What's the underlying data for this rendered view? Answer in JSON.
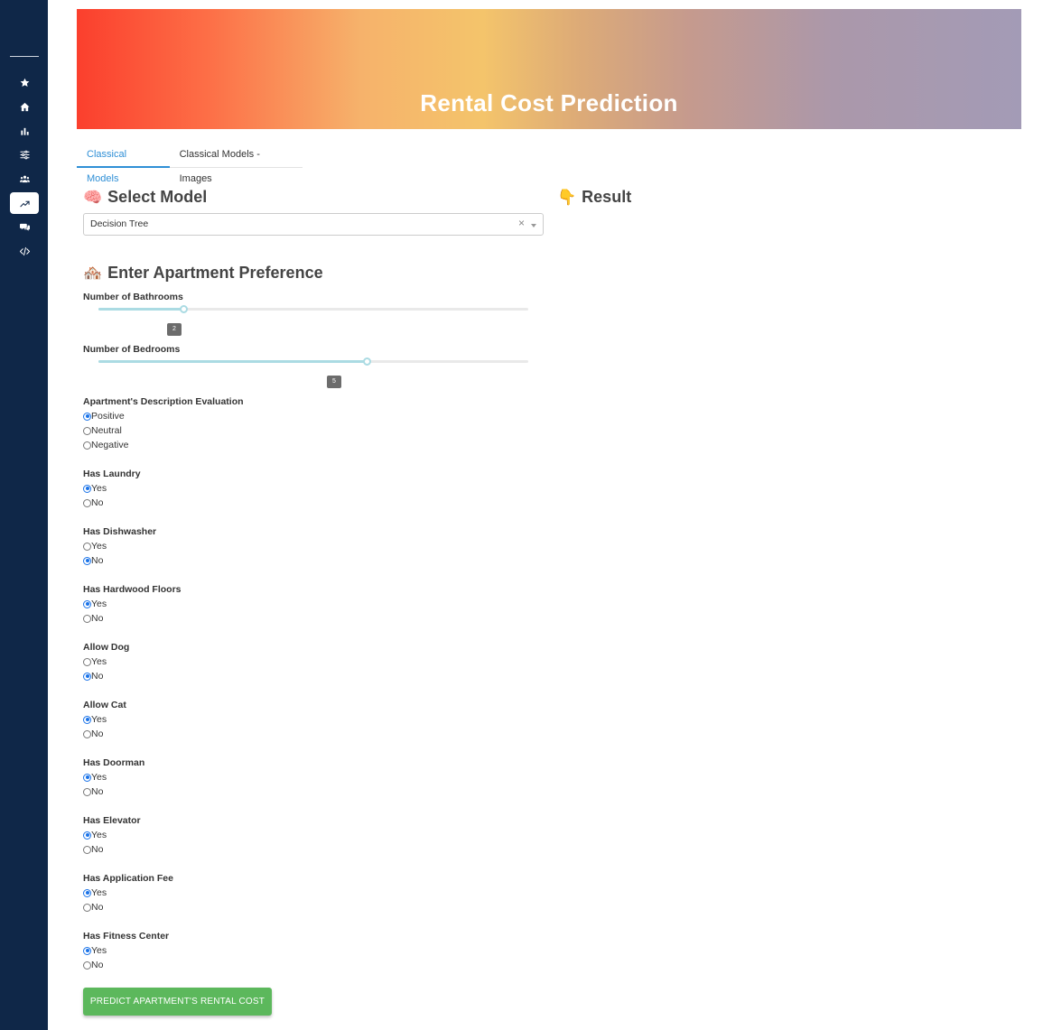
{
  "banner": {
    "title": "Rental Cost Prediction"
  },
  "tabs": [
    {
      "label": "Classical Models",
      "active": true
    },
    {
      "label": "Classical Models - Images",
      "active": false
    }
  ],
  "sidebar": {
    "items": [
      {
        "icon": "star-icon"
      },
      {
        "icon": "home-icon"
      },
      {
        "icon": "bar-chart-icon"
      },
      {
        "icon": "sliders-icon"
      },
      {
        "icon": "users-icon"
      },
      {
        "icon": "trend-up-icon",
        "active": true
      },
      {
        "icon": "comments-icon"
      },
      {
        "icon": "code-icon"
      }
    ]
  },
  "model_section": {
    "emoji": "🧠",
    "heading": "Select Model",
    "selected": "Decision Tree",
    "clear_symbol": "×"
  },
  "result_section": {
    "emoji": "👇",
    "heading": "Result"
  },
  "preference_section": {
    "emoji": "🏘️",
    "heading": "Enter Apartment Preference",
    "bathrooms": {
      "label": "Number of Bathrooms",
      "value": "2"
    },
    "bedrooms": {
      "label": "Number of Bedrooms",
      "value": "5"
    }
  },
  "questions": [
    {
      "label": "Apartment's Description Evaluation",
      "options": [
        "Positive",
        "Neutral",
        "Negative"
      ],
      "selected": 0
    },
    {
      "label": "Has Laundry",
      "options": [
        "Yes",
        "No"
      ],
      "selected": 0
    },
    {
      "label": "Has Dishwasher",
      "options": [
        "Yes",
        "No"
      ],
      "selected": 1
    },
    {
      "label": "Has Hardwood Floors",
      "options": [
        "Yes",
        "No"
      ],
      "selected": 0
    },
    {
      "label": "Allow Dog",
      "options": [
        "Yes",
        "No"
      ],
      "selected": 1
    },
    {
      "label": "Allow Cat",
      "options": [
        "Yes",
        "No"
      ],
      "selected": 0
    },
    {
      "label": "Has Doorman",
      "options": [
        "Yes",
        "No"
      ],
      "selected": 0
    },
    {
      "label": "Has Elevator",
      "options": [
        "Yes",
        "No"
      ],
      "selected": 0
    },
    {
      "label": "Has Application Fee",
      "options": [
        "Yes",
        "No"
      ],
      "selected": 0
    },
    {
      "label": "Has Fitness Center",
      "options": [
        "Yes",
        "No"
      ],
      "selected": 0
    }
  ],
  "predict_button": {
    "label": "PREDICT APARTMENT'S RENTAL COST"
  },
  "colors": {
    "sidebar": "#0f2748",
    "accent": "#2f8fd6",
    "slider": "#abdbe3",
    "button": "#5cb85c"
  }
}
